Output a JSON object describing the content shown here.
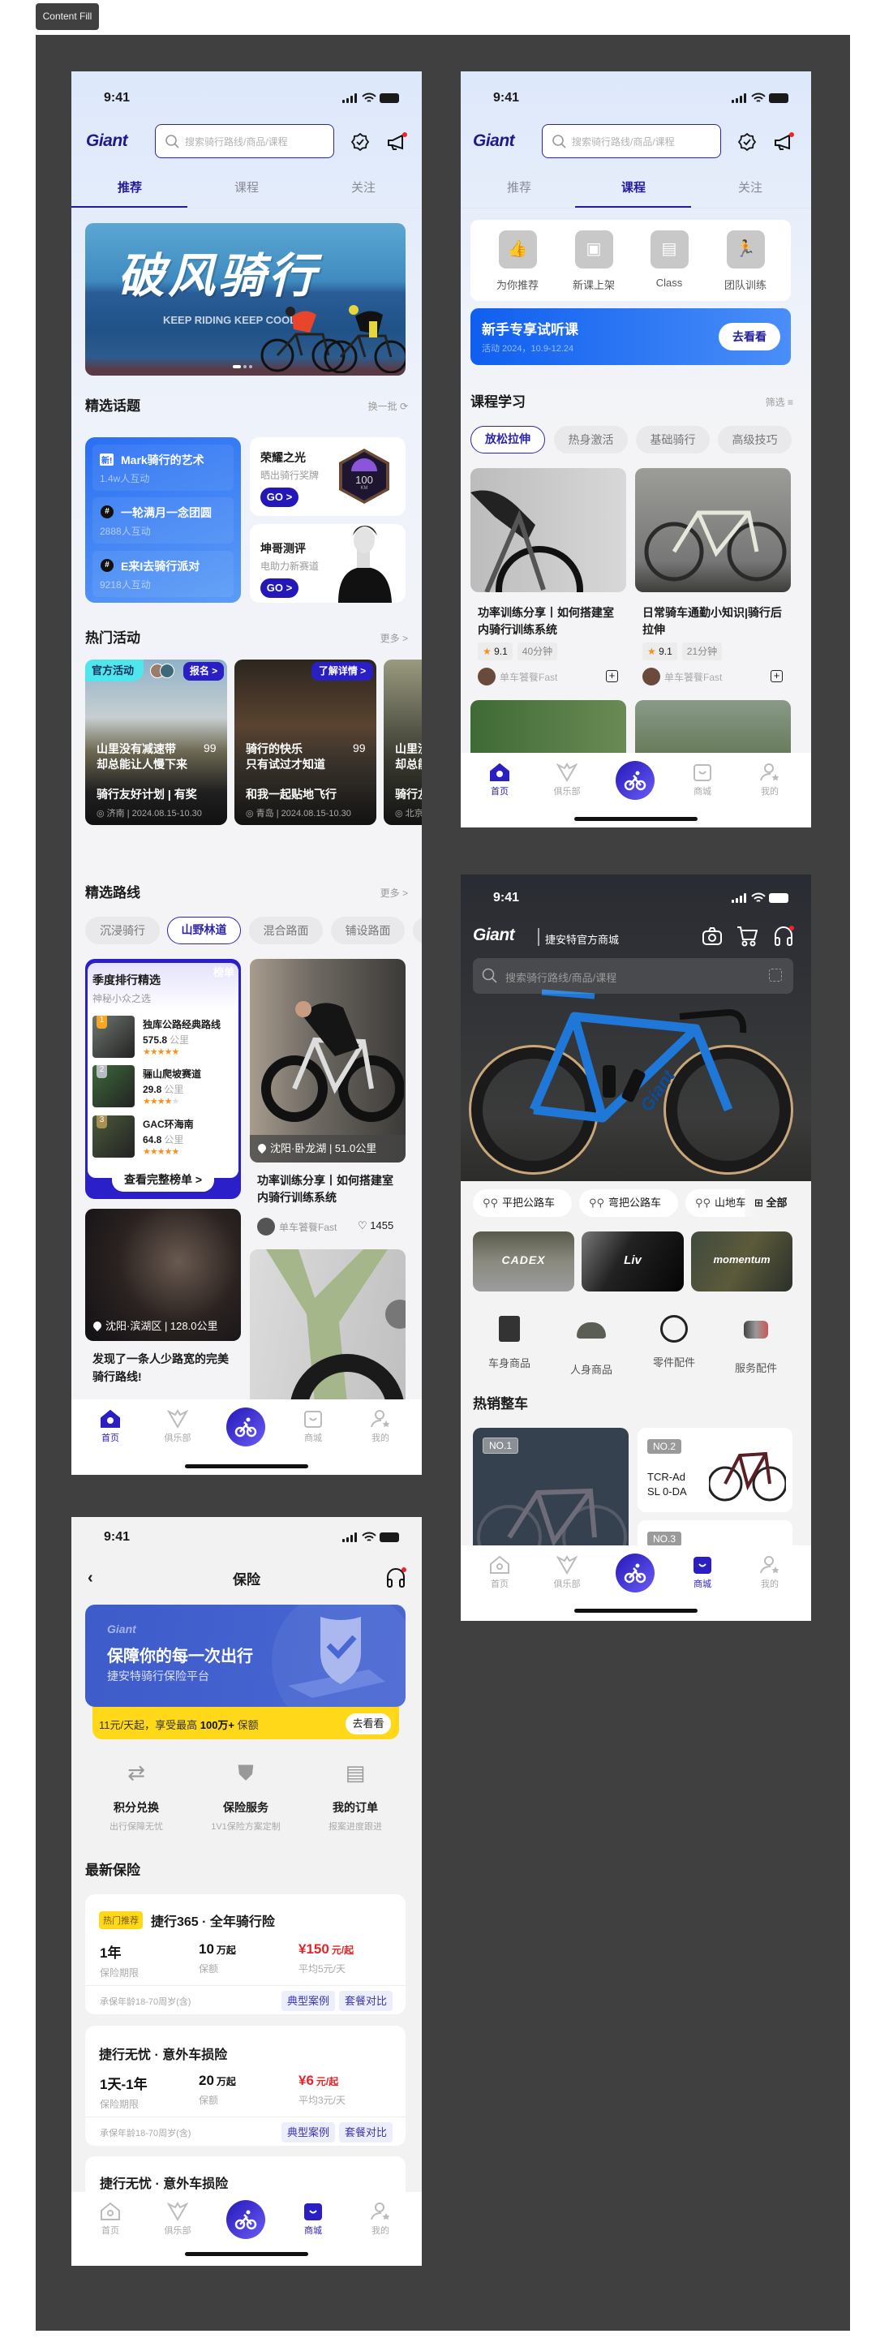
{
  "canvas_label": "Content Fill",
  "status": {
    "time": "9:41"
  },
  "brand": "Giant",
  "search_placeholder": "搜索骑行路线/商品/课程",
  "tabs": [
    "推荐",
    "课程",
    "关注"
  ],
  "nav": [
    "首页",
    "俱乐部",
    "商城",
    "我的"
  ],
  "colors": {
    "accent": "#231c9c",
    "blue": "#2f76f5",
    "price_red": "#e0262b",
    "yellow": "#ffd81a"
  },
  "home": {
    "banner": {
      "title": "破风骑行",
      "subtitle": "KEEP RIDING KEEP COOL."
    },
    "topics": {
      "title": "精选话题",
      "refresh": "换一批",
      "list": [
        {
          "badge": "新!",
          "title": "Mark骑行的艺术",
          "count": "1.4w人互动"
        },
        {
          "badge": "#",
          "title": "一轮满月一念团圆",
          "count": "2888人互动"
        },
        {
          "badge": "#",
          "title": "E来I去骑行派对",
          "count": "9218人互动"
        }
      ],
      "cards": [
        {
          "title": "荣耀之光",
          "sub": "晒出骑行奖牌",
          "go": "GO >",
          "medal": "100",
          "medal_unit": "KM"
        },
        {
          "title": "坤哥测评",
          "sub": "电助力新赛道",
          "go": "GO >"
        }
      ]
    },
    "activities": {
      "title": "热门活动",
      "more": "更多 >",
      "official_tag": "官方活动",
      "list": [
        {
          "action": "报名 >",
          "title1": "山里没有减速带",
          "title2": "却总能让人慢下来",
          "count": "99",
          "sub": "骑行友好计划 | 有奖",
          "meta": "济南 | 2024.08.15-10.30"
        },
        {
          "action": "了解详情 >",
          "title1": "骑行的快乐",
          "title2": "只有试过才知道",
          "count": "99",
          "sub": "和我一起贴地飞行",
          "meta": "青岛 | 2024.08.15-10.30"
        },
        {
          "action": "",
          "title1": "山里没有减速带",
          "title2": "却总能让人慢下来",
          "count": "",
          "sub": "骑行友好计划",
          "meta": "北京"
        }
      ]
    },
    "routes": {
      "title": "精选路线",
      "more": "更多 >",
      "chips": [
        "沉浸骑行",
        "山野林道",
        "混合路面",
        "铺设路面"
      ],
      "active_chip": 1,
      "ranking": {
        "tag": "榜单",
        "title": "季度排行精选",
        "sub": "神秘小众之选",
        "button": "查看完整榜单 >",
        "items": [
          {
            "rank": "1",
            "name": "独库公路经典路线",
            "dist": "575.8",
            "unit": "公里",
            "rating": 5
          },
          {
            "rank": "2",
            "name": "骊山爬坡赛道",
            "dist": "29.8",
            "unit": "公里",
            "rating": 4
          },
          {
            "rank": "3",
            "name": "GAC环海南",
            "dist": "64.8",
            "unit": "公里",
            "rating": 5
          }
        ]
      },
      "post1": {
        "location": "沈阳·卧龙湖 | 51.0公里",
        "title": "功率训练分享丨如何搭建室内骑行训练系统",
        "author": "单车饕餮Fast",
        "likes": "1455"
      },
      "post2": {
        "location": "沈阳·滨湖区 | 128.0公里",
        "title": "发现了一条人少路宽的完美骑行路线!"
      }
    }
  },
  "course": {
    "shortcuts": [
      "为你推荐",
      "新课上架",
      "Class",
      "团队训练"
    ],
    "promo": {
      "title": "新手专享试听课",
      "sub": "活动 2024，10.9-12.24",
      "button": "去看看"
    },
    "section": "课程学习",
    "filter": "筛选",
    "chips": [
      "放松拉伸",
      "热身激活",
      "基础骑行",
      "高级技巧"
    ],
    "cards": [
      {
        "title": "功率训练分享丨如何搭建室内骑行训练系统",
        "rating": "9.1",
        "duration": "40分钟",
        "author": "单车饕餮Fast"
      },
      {
        "title": "日常骑车通勤小知识|骑行后拉伸",
        "rating": "9.1",
        "duration": "21分钟",
        "author": "单车饕餮Fast"
      }
    ]
  },
  "shop": {
    "subtitle": "捷安特官方商城",
    "hero_bike_brand": "Giant",
    "types": [
      "平把公路车",
      "弯把公路车",
      "山地车",
      "全部"
    ],
    "brands": [
      "CADEX",
      "Liv",
      "momentum"
    ],
    "categories": [
      "车身商品",
      "人身商品",
      "零件配件",
      "服务配件"
    ],
    "hot_title": "热销整车",
    "hot": [
      {
        "rank": "NO.1"
      },
      {
        "rank": "NO.2",
        "name": "TCR-Ad SL 0-DA"
      },
      {
        "rank": "NO.3"
      }
    ]
  },
  "insurance": {
    "title": "保险",
    "banner": {
      "brand": "Giant",
      "title": "保障你的每一次出行",
      "sub": "捷安特骑行保险平台"
    },
    "strip": {
      "pre": "11元/天起，享受最高 ",
      "bold": "100万+",
      "post": " 保额",
      "button": "去看看"
    },
    "services": [
      {
        "title": "积分兑换",
        "sub": "出行保障无忧"
      },
      {
        "title": "保险服务",
        "sub": "1V1保险方案定制"
      },
      {
        "title": "我的订单",
        "sub": "报案进度跟进"
      }
    ],
    "section": "最新保险",
    "products": [
      {
        "tag": "热门推荐",
        "name": "捷行365 · 全年骑行险",
        "term": "1年",
        "term_label": "保险期限",
        "cover": "10",
        "cover_unit": "万起",
        "cover_label": "保额",
        "price": "¥150",
        "price_unit": "元/起",
        "avg": "平均5元/天",
        "age": "承保年龄18-70周岁(含)",
        "btn1": "典型案例",
        "btn2": "套餐对比"
      },
      {
        "tag": "",
        "name": "捷行无忧 · 意外车损险",
        "term": "1天-1年",
        "term_label": "保险期限",
        "cover": "20",
        "cover_unit": "万起",
        "cover_label": "保额",
        "price": "¥6",
        "price_unit": "元/起",
        "avg": "平均3元/天",
        "age": "承保年龄18-70周岁(含)",
        "btn1": "典型案例",
        "btn2": "套餐对比"
      },
      {
        "tag": "",
        "name": "捷行无忧 · 意外车损险"
      }
    ]
  }
}
